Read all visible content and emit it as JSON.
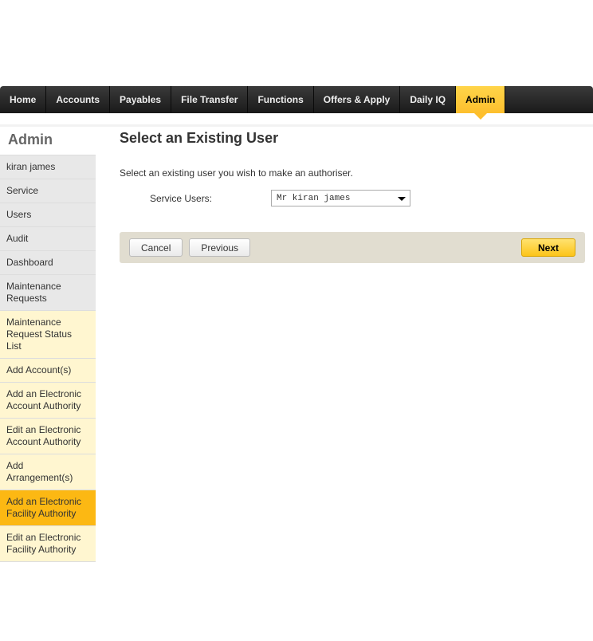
{
  "topnav": {
    "items": [
      {
        "label": "Home"
      },
      {
        "label": "Accounts"
      },
      {
        "label": "Payables"
      },
      {
        "label": "File Transfer"
      },
      {
        "label": "Functions"
      },
      {
        "label": "Offers & Apply"
      },
      {
        "label": "Daily IQ"
      },
      {
        "label": "Admin"
      }
    ]
  },
  "sidebar": {
    "title": "Admin",
    "items": [
      {
        "label": "kiran james"
      },
      {
        "label": "Service"
      },
      {
        "label": "Users"
      },
      {
        "label": "Audit"
      },
      {
        "label": "Dashboard"
      },
      {
        "label": "Maintenance Requests"
      },
      {
        "label": "Maintenance Request Status List"
      },
      {
        "label": "Add Account(s)"
      },
      {
        "label": "Add an Electronic Account Authority"
      },
      {
        "label": "Edit an Electronic Account Authority"
      },
      {
        "label": "Add Arrangement(s)"
      },
      {
        "label": "Add an Electronic Facility Authority"
      },
      {
        "label": "Edit an Electronic Facility Authority"
      }
    ]
  },
  "main": {
    "title": "Select an Existing User",
    "description": "Select an existing user you wish to make an authoriser.",
    "form": {
      "serviceUsers": {
        "label": "Service Users:",
        "value": "Mr kiran james"
      }
    },
    "buttons": {
      "cancel": "Cancel",
      "previous": "Previous",
      "next": "Next"
    }
  }
}
